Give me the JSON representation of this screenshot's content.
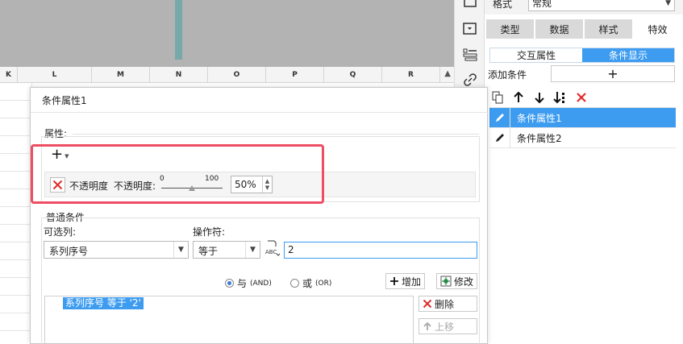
{
  "spreadsheet": {
    "columns": [
      "K",
      "L",
      "M",
      "N",
      "O",
      "P",
      "Q",
      "R"
    ]
  },
  "right_panel": {
    "format_label": "格式",
    "format_value": "常规",
    "tabs": [
      {
        "label": "类型",
        "active": false
      },
      {
        "label": "数据",
        "active": false
      },
      {
        "label": "样式",
        "active": false
      },
      {
        "label": "特效",
        "active": true
      }
    ],
    "subtabs": [
      {
        "label": "交互属性",
        "active": false
      },
      {
        "label": "条件显示",
        "active": true
      }
    ],
    "add_condition_label": "添加条件",
    "add_condition_button": "+",
    "condition_items": [
      {
        "label": "条件属性1",
        "active": true
      },
      {
        "label": "条件属性2",
        "active": false
      }
    ]
  },
  "dialog": {
    "title": "条件属性1",
    "attributes_group": "属性:",
    "add_button": "+",
    "property": {
      "name": "不透明度",
      "label": "不透明度:",
      "slider_min": "0",
      "slider_max": "100",
      "opacity_fraction": 0.5,
      "value_text": "50%"
    },
    "normal_conditions_group": "普通条件",
    "selectable_columns_label": "可选列:",
    "selectable_column_value": "系列序号",
    "operator_label": "操作符:",
    "operator_value": "等于",
    "value_input": "2",
    "radio_and": {
      "label": "与",
      "sub": "(AND)",
      "selected": true
    },
    "radio_or": {
      "label": "或",
      "sub": "(OR)",
      "selected": false
    },
    "add_btn": "增加",
    "modify_btn": "修改",
    "delete_btn": "删除",
    "move_up_btn": "上移",
    "expression": "系列序号 等于 '2'"
  },
  "colors": {
    "accent": "#3d9cf0",
    "highlight_border": "#ee4e63",
    "delete_red": "#e02b2b",
    "teal": "#79a8aa"
  }
}
